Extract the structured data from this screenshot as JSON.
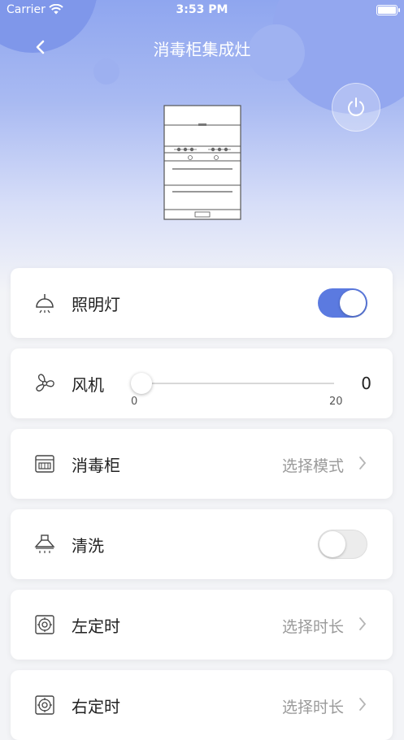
{
  "status_bar": {
    "carrier": "Carrier",
    "time": "3:53 PM"
  },
  "header": {
    "title": "消毒柜集成灶"
  },
  "controls": {
    "light": {
      "label": "照明灯",
      "state": "on"
    },
    "fan": {
      "label": "风机",
      "value": "0",
      "min": "0",
      "max": "20",
      "level": 0
    },
    "sterilizer": {
      "label": "消毒柜",
      "action": "选择模式"
    },
    "clean": {
      "label": "清洗",
      "state": "off"
    },
    "left_timer": {
      "label": "左定时",
      "action": "选择时长"
    },
    "right_timer": {
      "label": "右定时",
      "action": "选择时长"
    }
  },
  "colors": {
    "accent": "#5b7ae0",
    "header_gradient_top": "#8fa6ef"
  }
}
